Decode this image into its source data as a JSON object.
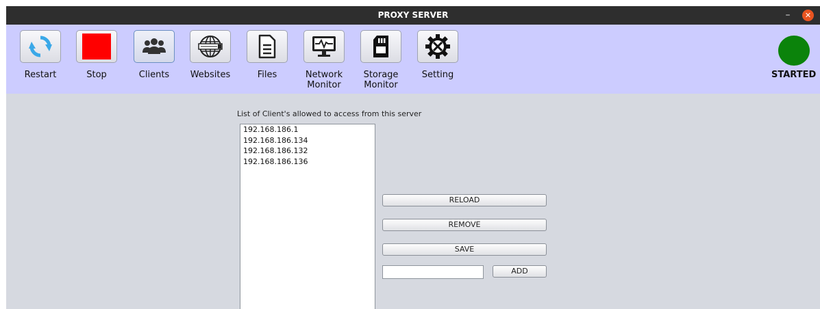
{
  "window": {
    "title": "PROXY SERVER"
  },
  "toolbar": {
    "items": [
      {
        "label": "Restart",
        "icon": "refresh-icon"
      },
      {
        "label": "Stop",
        "icon": "stop-icon"
      },
      {
        "label": "Clients",
        "icon": "users-icon"
      },
      {
        "label": "Websites",
        "icon": "globe-icon"
      },
      {
        "label": "Files",
        "icon": "document-icon"
      },
      {
        "label": "Network Monitor",
        "icon": "network-monitor-icon"
      },
      {
        "label": "Storage Monitor",
        "icon": "sd-card-icon"
      },
      {
        "label": "Setting",
        "icon": "gear-tools-icon"
      }
    ],
    "status": {
      "label": "STARTED",
      "color": "#0b830b"
    }
  },
  "clients": {
    "caption": "List of Client's allowed to access from this server",
    "items": [
      "192.168.186.1",
      "192.168.186.134",
      "192.168.186.132",
      "192.168.186.136"
    ],
    "reload_label": "RELOAD",
    "remove_label": "REMOVE",
    "save_label": "SAVE",
    "add_label": "ADD",
    "add_value": ""
  },
  "colors": {
    "toolbar_bg": "#ccccff",
    "content_bg": "#d6d9e0",
    "titlebar_bg": "#2e2e2e",
    "close_button": "#e95420"
  }
}
